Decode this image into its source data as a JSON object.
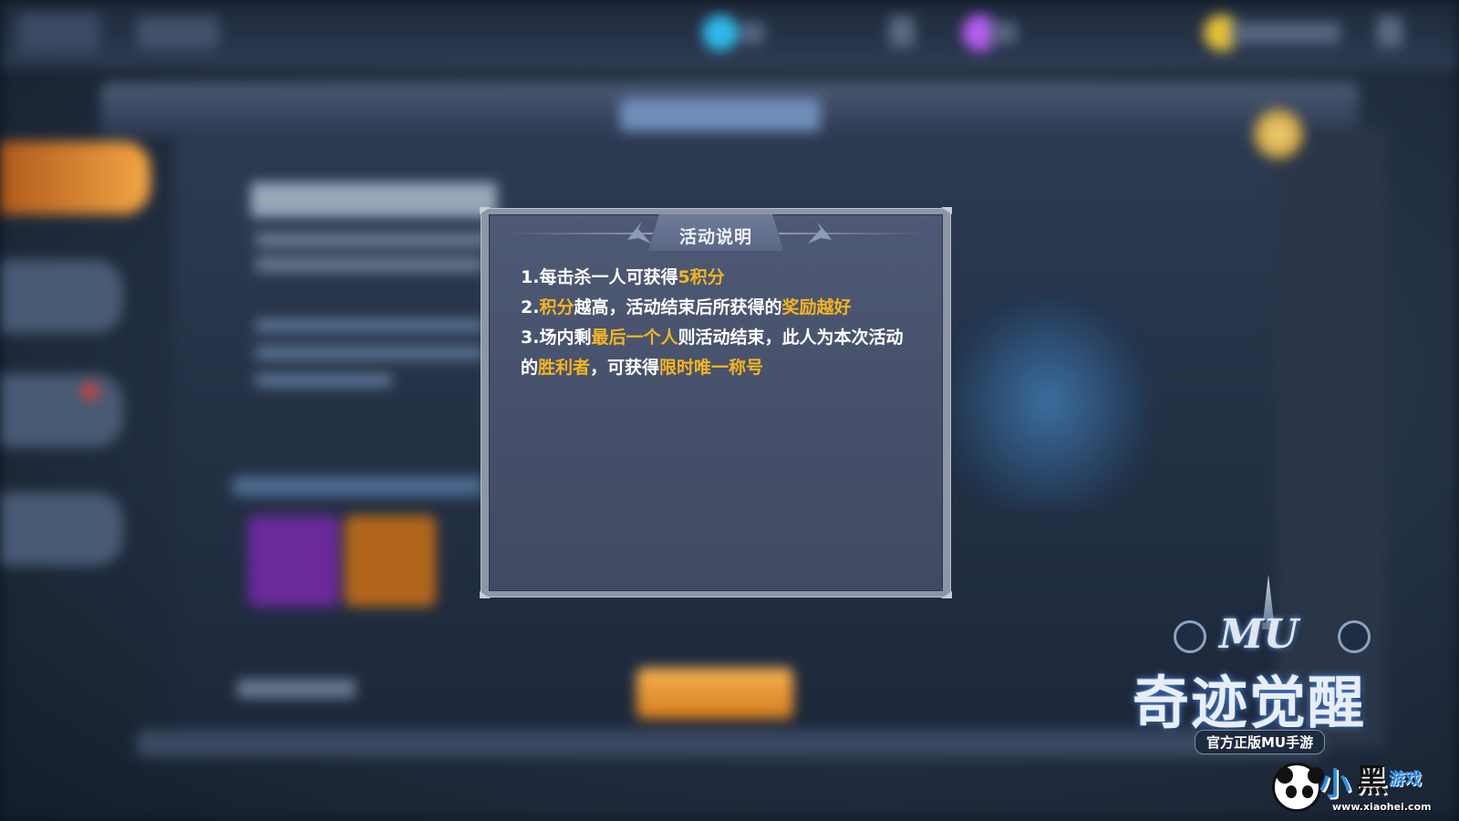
{
  "popup": {
    "title": "活动说明",
    "lines": [
      [
        {
          "text": "1.每击杀一人可获得",
          "highlight": false
        },
        {
          "text": "5积分",
          "highlight": true
        }
      ],
      [
        {
          "text": "2.",
          "highlight": false
        },
        {
          "text": "积分",
          "highlight": true
        },
        {
          "text": "越高，活动结束后所获得的",
          "highlight": false
        },
        {
          "text": "奖励越好",
          "highlight": true
        }
      ],
      [
        {
          "text": "3.场内剩",
          "highlight": false
        },
        {
          "text": "最后一个人",
          "highlight": true
        },
        {
          "text": "则活动结束，此人为本次活动的",
          "highlight": false
        },
        {
          "text": "胜利者",
          "highlight": true
        },
        {
          "text": "，可获得",
          "highlight": false
        },
        {
          "text": "限时唯一称号",
          "highlight": true
        }
      ]
    ]
  },
  "logo": {
    "brand": "MU",
    "title": "奇迹觉醒",
    "subtitle": "官方正版MU手游"
  },
  "watermark": {
    "xiao": "小",
    "hei": "黑",
    "youxi": "游戏",
    "url": "www.xiaohei.com"
  },
  "colors": {
    "highlight": "#f4b51f",
    "popup_body": "#4a5570",
    "popup_text": "#ffffff"
  }
}
